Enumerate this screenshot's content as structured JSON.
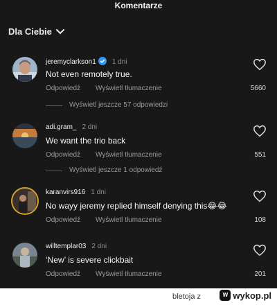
{
  "header": {
    "title": "Komentarze"
  },
  "filter": {
    "label": "Dla Ciebie"
  },
  "comments": [
    {
      "user": "jeremyclarkson1",
      "verified": true,
      "date": "1 dni",
      "text": "Not even remotely true.",
      "reply_label": "Odpowiedź",
      "translate_label": "Wyświetl tłumaczenie",
      "likes": "5660",
      "more_replies": "Wyświetl jeszcze 57 odpowiedzi"
    },
    {
      "user": "adi.gram_",
      "verified": false,
      "date": "2 dni",
      "text": "We want the trio back",
      "reply_label": "Odpowiedź",
      "translate_label": "Wyświetl tłumaczenie",
      "likes": "551",
      "more_replies": "Wyświetl jeszcze 1 odpowiedź"
    },
    {
      "user": "karanvirs916",
      "verified": false,
      "date": "1 dni",
      "text": "No wayy jeremy replied himself denying this😂😂",
      "reply_label": "Odpowiedź",
      "translate_label": "Wyświetl tłumaczenie",
      "likes": "108",
      "more_replies": ""
    },
    {
      "user": "willtemplar03",
      "verified": false,
      "date": "2 dni",
      "text": "‘New’ is severe clickbait",
      "reply_label": "Odpowiedź",
      "translate_label": "Wyświetl tłumaczenie",
      "likes": "201",
      "more_replies": ""
    }
  ],
  "footer": {
    "author": "bletoja z",
    "site": "wykop.pl"
  },
  "colors": {
    "background": "#181818",
    "verified": "#3797f0"
  }
}
